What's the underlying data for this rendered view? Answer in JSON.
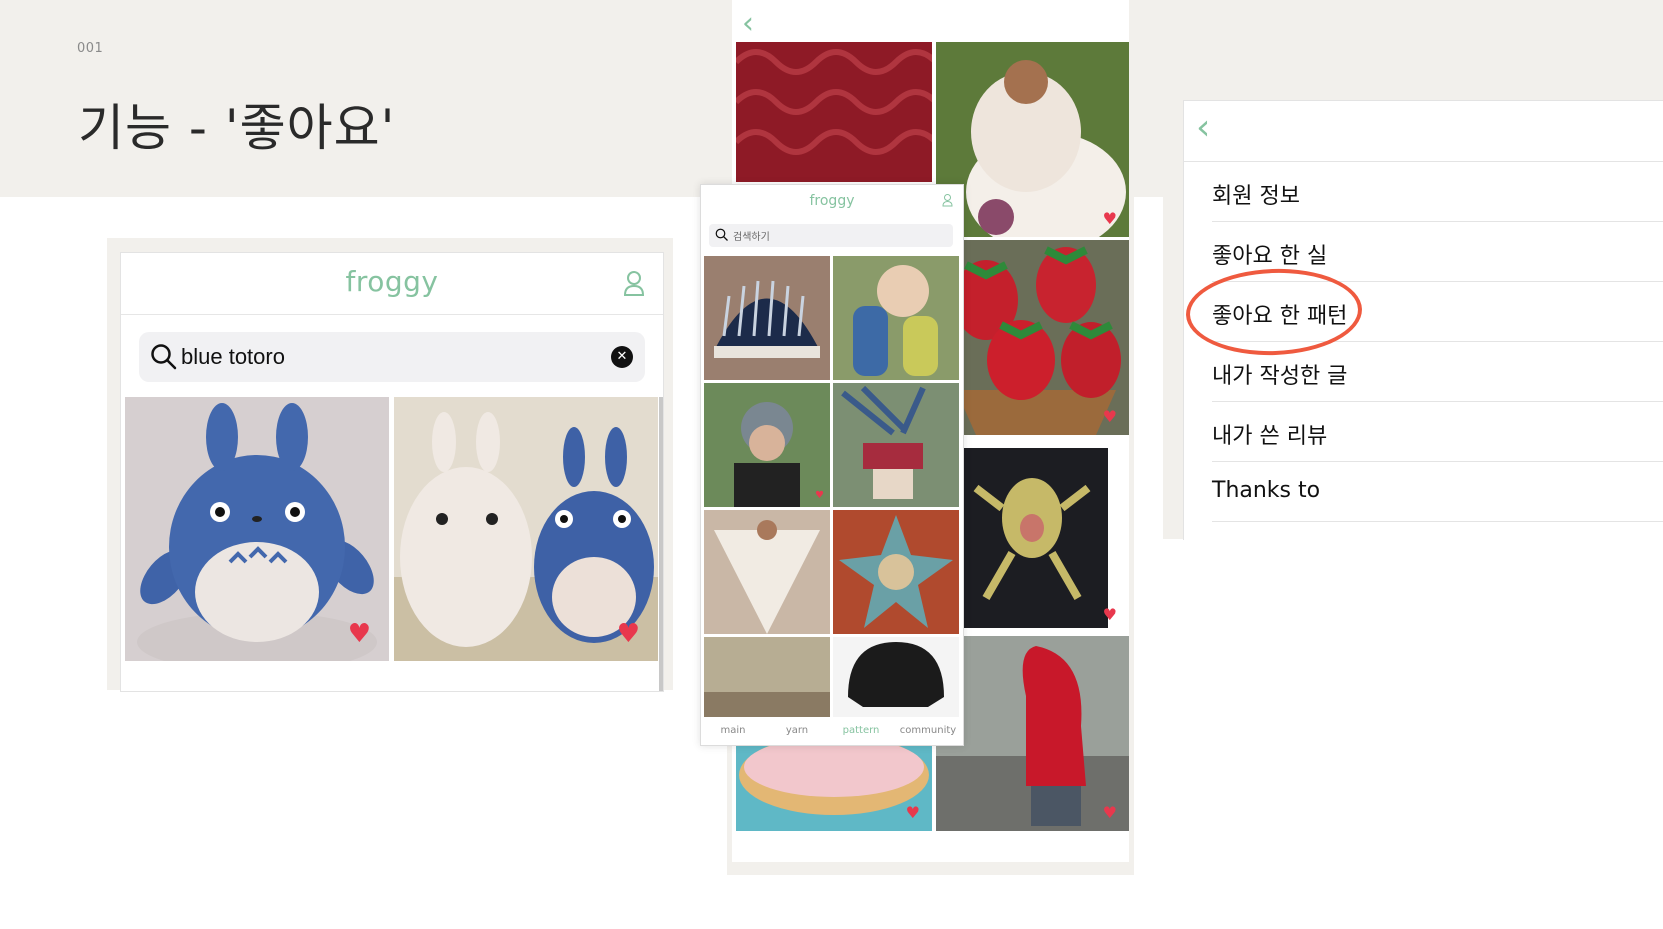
{
  "slide": {
    "number": "001",
    "title": "기능 - '좋아요'"
  },
  "colors": {
    "brand_green": "#86c3a0",
    "heart_red": "#e8384d",
    "highlight_orange": "#ef5a3f",
    "band_beige": "#f2f0ec"
  },
  "search_screen": {
    "brand": "froggy",
    "search_value": "blue totoro",
    "icons": [
      "user-icon",
      "search-icon",
      "clear-icon",
      "heart-icon"
    ],
    "results": [
      {
        "liked": true
      },
      {
        "liked": true
      }
    ]
  },
  "pattern_screen": {
    "brand": "froggy",
    "search_placeholder": "검색하기",
    "tabs": [
      "main",
      "yarn",
      "pattern",
      "community"
    ],
    "active_tab": "pattern"
  },
  "menu_screen": {
    "items": [
      "회원 정보",
      "좋아요 한 실",
      "좋아요 한 패턴",
      "내가 작성한 글",
      "내가 쓴 리뷰",
      "Thanks to"
    ],
    "highlighted_item": "좋아요 한 패턴"
  }
}
